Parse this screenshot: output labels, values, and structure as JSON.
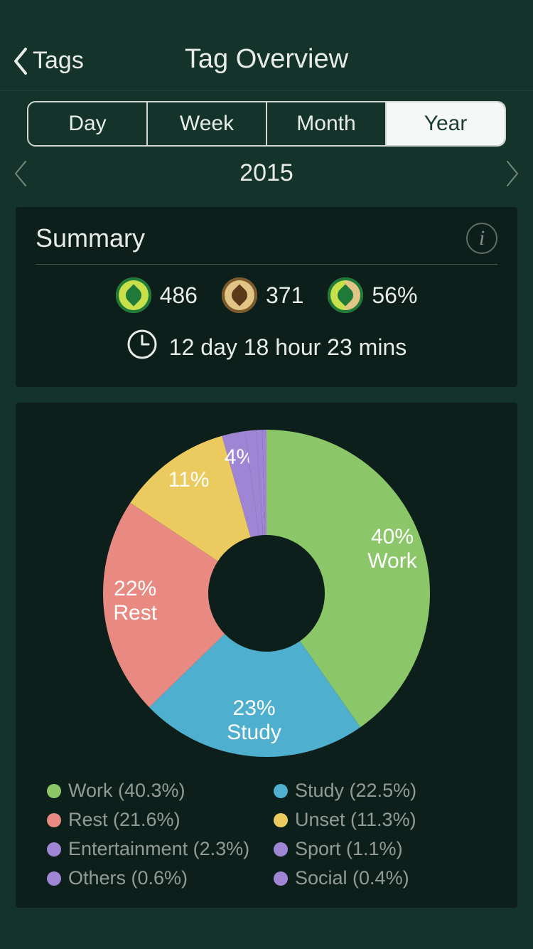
{
  "header": {
    "back_label": "Tags",
    "title": "Tag Overview"
  },
  "segmented": {
    "items": [
      {
        "label": "Day",
        "active": false
      },
      {
        "label": "Week",
        "active": false
      },
      {
        "label": "Month",
        "active": false
      },
      {
        "label": "Year",
        "active": true
      }
    ]
  },
  "period": {
    "label": "2015"
  },
  "summary": {
    "title": "Summary",
    "stats": {
      "success": "486",
      "fail": "371",
      "rate": "56%"
    },
    "total_time": "12 day 18 hour 23 mins"
  },
  "chart_data": {
    "type": "pie",
    "title": "",
    "inner_radius_pct": 34,
    "series": [
      {
        "name": "Work",
        "value": 40.3,
        "color": "#8bc768",
        "slice_label": "40%\nWork"
      },
      {
        "name": "Study",
        "value": 22.5,
        "color": "#4eb0ce",
        "slice_label": "23%\nStudy"
      },
      {
        "name": "Rest",
        "value": 21.6,
        "color": "#e88a81",
        "slice_label": "22%\nRest"
      },
      {
        "name": "Unset",
        "value": 11.3,
        "color": "#ebcb60",
        "slice_label": "11%"
      },
      {
        "name": "Entertainment",
        "value": 2.3,
        "color": "#9f86d4",
        "slice_label": "4%"
      },
      {
        "name": "Sport",
        "value": 1.1,
        "color": "#9f86d4",
        "slice_label": ""
      },
      {
        "name": "Others",
        "value": 0.6,
        "color": "#9f86d4",
        "slice_label": ""
      },
      {
        "name": "Social",
        "value": 0.4,
        "color": "#9f86d4",
        "slice_label": ""
      }
    ]
  }
}
